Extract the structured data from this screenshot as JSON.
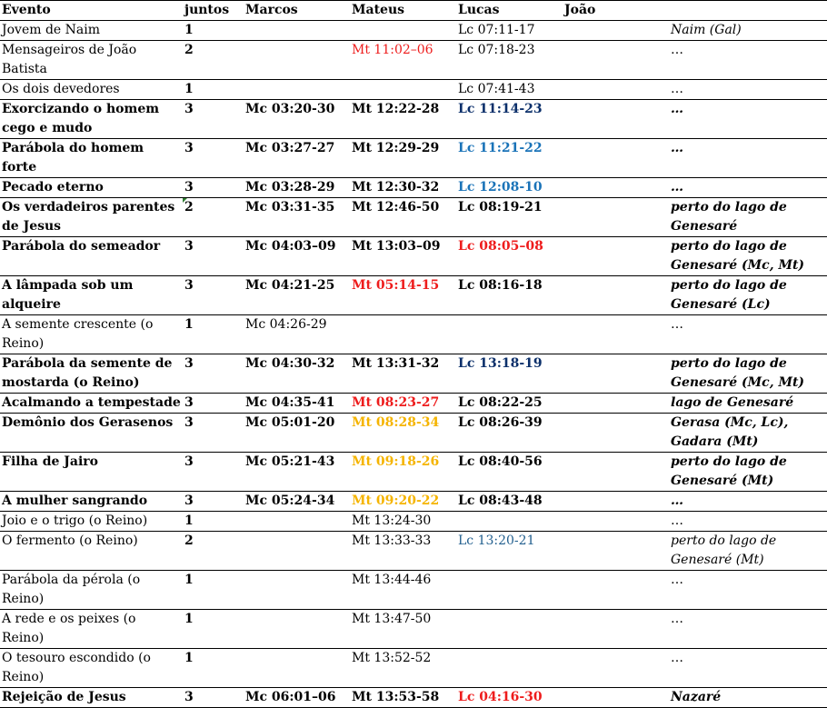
{
  "header": {
    "evento": "Evento",
    "juntos": "juntos",
    "marcos": "Marcos",
    "mateus": "Mateus",
    "lucas": "Lucas",
    "joao": "João"
  },
  "colors": {
    "red": "#ee1c1c",
    "orange": "#f5b400",
    "navy": "#0b2f6a",
    "blue": "#1a73b8",
    "teal": "#23608f"
  },
  "rows": [
    {
      "evento": "Jovem de Naim",
      "juntos": "1",
      "marcos": "",
      "mateus": "",
      "lucas": "Lc 07:11-17",
      "joao": "",
      "local": "Naim (Gal)"
    },
    {
      "evento": "Mensageiros de João Batista",
      "juntos": "2",
      "marcos": "",
      "mateus": "Mt 11:02–06",
      "lucas": "Lc 07:18-23",
      "joao": "",
      "local": "…"
    },
    {
      "evento": "Os dois devedores",
      "juntos": "1",
      "marcos": "",
      "mateus": "",
      "lucas": "Lc 07:41-43",
      "joao": "",
      "local": "…"
    },
    {
      "evento": "Exorcizando o homem cego e mudo",
      "juntos": "3",
      "marcos": "Mc 03:20-30",
      "mateus": "Mt 12:22-28",
      "lucas": "Lc 11:14-23",
      "joao": "",
      "local": "…"
    },
    {
      "evento": "Parábola do homem forte",
      "juntos": "3",
      "marcos": "Mc 03:27-27",
      "mateus": "Mt 12:29-29",
      "lucas": "Lc 11:21-22",
      "joao": "",
      "local": "…"
    },
    {
      "evento": "Pecado eterno",
      "juntos": "3",
      "marcos": "Mc 03:28-29",
      "mateus": "Mt 12:30-32",
      "lucas": "Lc 12:08-10",
      "joao": "",
      "local": "…"
    },
    {
      "evento": "Os verdadeiros parentes de Jesus",
      "juntos": "2",
      "marcos": "Mc 03:31-35",
      "mateus": "Mt 12:46-50",
      "lucas": "Lc 08:19-21",
      "joao": "",
      "local": "perto do lago de Genesaré"
    },
    {
      "evento": "Parábola do semeador",
      "juntos": "3",
      "marcos": "Mc 04:03–09",
      "mateus": "Mt 13:03–09",
      "lucas": "Lc 08:05–08",
      "joao": "",
      "local": "perto do lago de Genesaré (Mc, Mt)"
    },
    {
      "evento": "A lâmpada sob um alqueire",
      "juntos": "3",
      "marcos": "Mc 04:21-25",
      "mateus": "Mt 05:14-15",
      "lucas": "Lc 08:16-18",
      "joao": "",
      "local": "perto do lago de Genesaré (Lc)"
    },
    {
      "evento": "A semente crescente (o Reino)",
      "juntos": "1",
      "marcos": "Mc 04:26-29",
      "mateus": "",
      "lucas": "",
      "joao": "",
      "local": "…"
    },
    {
      "evento": "Parábola da semente de mostarda (o Reino)",
      "juntos": "3",
      "marcos": "Mc 04:30-32",
      "mateus": "Mt 13:31-32",
      "lucas": "Lc 13:18-19",
      "joao": "",
      "local": "perto do lago de Genesaré (Mc, Mt)"
    },
    {
      "evento": "Acalmando a tempestade",
      "juntos": "3",
      "marcos": "Mc 04:35-41",
      "mateus": "Mt 08:23-27",
      "lucas": "Lc 08:22-25",
      "joao": "",
      "local": "lago de Genesaré"
    },
    {
      "evento": "Demônio dos Gerasenos",
      "juntos": "3",
      "marcos": "Mc 05:01-20",
      "mateus": "Mt 08:28-34",
      "lucas": "Lc 08:26-39",
      "joao": "",
      "local": "Gerasa (Mc, Lc), Gadara (Mt)"
    },
    {
      "evento": "Filha de Jairo",
      "juntos": "3",
      "marcos": "Mc 05:21-43",
      "mateus": "Mt 09:18-26",
      "lucas": "Lc 08:40-56",
      "joao": "",
      "local": "perto do lago de Genesaré (Mt)"
    },
    {
      "evento": "A mulher sangrando",
      "juntos": "3",
      "marcos": "Mc 05:24-34",
      "mateus": "Mt 09:20-22",
      "lucas": "Lc 08:43-48",
      "joao": "",
      "local": "…"
    },
    {
      "evento": "Joio e o trigo (o Reino)",
      "juntos": "1",
      "marcos": "",
      "mateus": "Mt 13:24-30",
      "lucas": "",
      "joao": "",
      "local": "…"
    },
    {
      "evento": "O fermento (o Reino)",
      "juntos": "2",
      "marcos": "",
      "mateus": "Mt 13:33-33",
      "lucas": "Lc 13:20-21",
      "joao": "",
      "local": "perto do lago de Genesaré (Mt)"
    },
    {
      "evento": "Parábola da pérola (o Reino)",
      "juntos": "1",
      "marcos": "",
      "mateus": "Mt 13:44-46",
      "lucas": "",
      "joao": "",
      "local": "…"
    },
    {
      "evento": "A rede e os peixes (o Reino)",
      "juntos": "1",
      "marcos": "",
      "mateus": "Mt 13:47-50",
      "lucas": "",
      "joao": "",
      "local": "…"
    },
    {
      "evento": "O tesouro escondido (o Reino)",
      "juntos": "1",
      "marcos": "",
      "mateus": "Mt 13:52-52",
      "lucas": "",
      "joao": "",
      "local": "…"
    },
    {
      "evento": "Rejeição de Jesus",
      "juntos": "3",
      "marcos": "Mc 06:01–06",
      "mateus": "Mt 13:53-58",
      "lucas": "Lc 04:16-30",
      "joao": "",
      "local": "Nazaré"
    }
  ]
}
